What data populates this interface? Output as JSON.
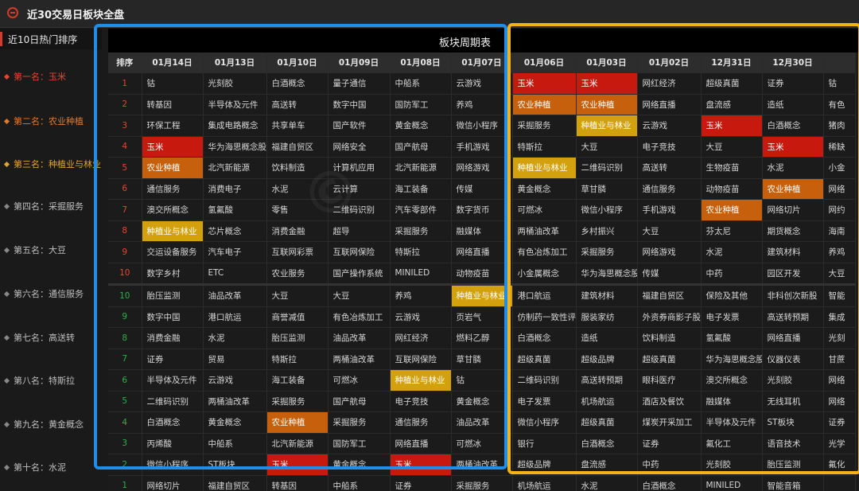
{
  "window": {
    "title": "近30交易日板块全盘"
  },
  "sidebar": {
    "header": "近10日热门排序",
    "items": [
      {
        "label": "第一名：玉米",
        "level": "top1"
      },
      {
        "label": "第二名：农业种植",
        "level": "top2"
      },
      {
        "label": "第三名：种植业与林业",
        "level": "top3"
      },
      {
        "label": "第四名：采掘服务",
        "level": ""
      },
      {
        "label": "第五名：大豆",
        "level": ""
      },
      {
        "label": "第六名：通信服务",
        "level": ""
      },
      {
        "label": "第七名：高送转",
        "level": ""
      },
      {
        "label": "第八名：特斯拉",
        "level": ""
      },
      {
        "label": "第九名：黄金概念",
        "level": ""
      },
      {
        "label": "第十名：水泥",
        "level": ""
      }
    ]
  },
  "panel": {
    "title": "板块周期表"
  },
  "table": {
    "rank_header": "排序",
    "dates": [
      "01月14日",
      "01月13日",
      "01月10日",
      "01月09日",
      "01月08日",
      "01月07日",
      "01月06日",
      "01月03日",
      "01月02日",
      "12月31日",
      "12月30日",
      ""
    ],
    "rows": [
      {
        "rank": "1",
        "dir": "up",
        "cells": [
          [
            "钴",
            ""
          ],
          [
            "光刻胶",
            ""
          ],
          [
            "白酒概念",
            ""
          ],
          [
            "量子通信",
            ""
          ],
          [
            "中船系",
            ""
          ],
          [
            "云游戏",
            ""
          ],
          [
            "玉米",
            "red"
          ],
          [
            "玉米",
            "red"
          ],
          [
            "网红经济",
            ""
          ],
          [
            "超级真菌",
            ""
          ],
          [
            "证券",
            ""
          ],
          [
            "钴",
            ""
          ]
        ]
      },
      {
        "rank": "2",
        "dir": "up",
        "cells": [
          [
            "转基因",
            ""
          ],
          [
            "半导体及元件",
            ""
          ],
          [
            "高送转",
            ""
          ],
          [
            "数字中国",
            ""
          ],
          [
            "国防军工",
            ""
          ],
          [
            "养鸡",
            ""
          ],
          [
            "农业种植",
            "org"
          ],
          [
            "农业种植",
            "org"
          ],
          [
            "网络直播",
            ""
          ],
          [
            "盘流感",
            ""
          ],
          [
            "造纸",
            ""
          ],
          [
            "有色",
            ""
          ]
        ]
      },
      {
        "rank": "3",
        "dir": "up",
        "cells": [
          [
            "环保工程",
            ""
          ],
          [
            "集成电路概念",
            ""
          ],
          [
            "共享单车",
            ""
          ],
          [
            "国产软件",
            ""
          ],
          [
            "黄金概念",
            ""
          ],
          [
            "微信小程序",
            ""
          ],
          [
            "采掘服务",
            ""
          ],
          [
            "种植业与林业",
            "yel"
          ],
          [
            "云游戏",
            ""
          ],
          [
            "玉米",
            "red"
          ],
          [
            "白酒概念",
            ""
          ],
          [
            "猪肉",
            ""
          ]
        ]
      },
      {
        "rank": "4",
        "dir": "up",
        "cells": [
          [
            "玉米",
            "red"
          ],
          [
            "华为海思概念股",
            ""
          ],
          [
            "福建自贸区",
            ""
          ],
          [
            "网络安全",
            ""
          ],
          [
            "国产航母",
            ""
          ],
          [
            "手机游戏",
            ""
          ],
          [
            "特斯拉",
            ""
          ],
          [
            "大豆",
            ""
          ],
          [
            "电子竞技",
            ""
          ],
          [
            "大豆",
            ""
          ],
          [
            "玉米",
            "red"
          ],
          [
            "稀缺",
            ""
          ]
        ]
      },
      {
        "rank": "5",
        "dir": "up",
        "cells": [
          [
            "农业种植",
            "org"
          ],
          [
            "北汽新能源",
            ""
          ],
          [
            "饮料制造",
            ""
          ],
          [
            "计算机应用",
            ""
          ],
          [
            "北汽新能源",
            ""
          ],
          [
            "网络游戏",
            ""
          ],
          [
            "种植业与林业",
            "yel"
          ],
          [
            "二维码识别",
            ""
          ],
          [
            "高送转",
            ""
          ],
          [
            "生物疫苗",
            ""
          ],
          [
            "水泥",
            ""
          ],
          [
            "小金",
            ""
          ]
        ]
      },
      {
        "rank": "6",
        "dir": "up",
        "cells": [
          [
            "通信服务",
            ""
          ],
          [
            "消费电子",
            ""
          ],
          [
            "水泥",
            ""
          ],
          [
            "云计算",
            ""
          ],
          [
            "海工装备",
            ""
          ],
          [
            "传媒",
            ""
          ],
          [
            "黄金概念",
            ""
          ],
          [
            "草甘膦",
            ""
          ],
          [
            "通信服务",
            ""
          ],
          [
            "动物疫苗",
            ""
          ],
          [
            "农业种植",
            "org"
          ],
          [
            "网络",
            ""
          ]
        ]
      },
      {
        "rank": "7",
        "dir": "up",
        "cells": [
          [
            "澳交所概念",
            ""
          ],
          [
            "氢氟酸",
            ""
          ],
          [
            "零售",
            ""
          ],
          [
            "二维码识别",
            ""
          ],
          [
            "汽车零部件",
            ""
          ],
          [
            "数字货币",
            ""
          ],
          [
            "可燃冰",
            ""
          ],
          [
            "微信小程序",
            ""
          ],
          [
            "手机游戏",
            ""
          ],
          [
            "农业种植",
            "org"
          ],
          [
            "网络切片",
            ""
          ],
          [
            "网约",
            ""
          ]
        ]
      },
      {
        "rank": "8",
        "dir": "up",
        "cells": [
          [
            "种植业与林业",
            "yel"
          ],
          [
            "芯片概念",
            ""
          ],
          [
            "消费金融",
            ""
          ],
          [
            "超导",
            ""
          ],
          [
            "采掘服务",
            ""
          ],
          [
            "融媒体",
            ""
          ],
          [
            "两桶油改革",
            ""
          ],
          [
            "乡村振兴",
            ""
          ],
          [
            "大豆",
            ""
          ],
          [
            "芬太尼",
            ""
          ],
          [
            "期货概念",
            ""
          ],
          [
            "海南",
            ""
          ]
        ]
      },
      {
        "rank": "9",
        "dir": "up",
        "cells": [
          [
            "交运设备服务",
            ""
          ],
          [
            "汽车电子",
            ""
          ],
          [
            "互联网彩票",
            ""
          ],
          [
            "互联网保险",
            ""
          ],
          [
            "特斯拉",
            ""
          ],
          [
            "网络直播",
            ""
          ],
          [
            "有色冶炼加工",
            ""
          ],
          [
            "采掘服务",
            ""
          ],
          [
            "网络游戏",
            ""
          ],
          [
            "水泥",
            ""
          ],
          [
            "建筑材料",
            ""
          ],
          [
            "养鸡",
            ""
          ]
        ]
      },
      {
        "rank": "10",
        "dir": "up",
        "cells": [
          [
            "数字乡村",
            ""
          ],
          [
            "ETC",
            ""
          ],
          [
            "农业服务",
            ""
          ],
          [
            "国产操作系统",
            ""
          ],
          [
            "MINILED",
            ""
          ],
          [
            "动物疫苗",
            ""
          ],
          [
            "小金属概念",
            ""
          ],
          [
            "华为海思概念股",
            ""
          ],
          [
            "传媒",
            ""
          ],
          [
            "中药",
            ""
          ],
          [
            "园区开发",
            ""
          ],
          [
            "大豆",
            ""
          ]
        ]
      },
      {
        "rank": "10",
        "dir": "dn",
        "sep": true,
        "cells": [
          [
            "胎压监测",
            ""
          ],
          [
            "油品改革",
            ""
          ],
          [
            "大豆",
            ""
          ],
          [
            "大豆",
            ""
          ],
          [
            "养鸡",
            ""
          ],
          [
            "种植业与林业",
            "yel"
          ],
          [
            "港口航运",
            ""
          ],
          [
            "建筑材料",
            ""
          ],
          [
            "福建自贸区",
            ""
          ],
          [
            "保险及其他",
            ""
          ],
          [
            "非科创次新股",
            ""
          ],
          [
            "智能",
            ""
          ]
        ]
      },
      {
        "rank": "9",
        "dir": "dn",
        "cells": [
          [
            "数字中国",
            ""
          ],
          [
            "港口航运",
            ""
          ],
          [
            "商誉减值",
            ""
          ],
          [
            "有色冶炼加工",
            ""
          ],
          [
            "云游戏",
            ""
          ],
          [
            "页岩气",
            ""
          ],
          [
            "仿制药一致性评价",
            ""
          ],
          [
            "服装家纺",
            ""
          ],
          [
            "外资券商影子股",
            ""
          ],
          [
            "电子发票",
            ""
          ],
          [
            "高送转预期",
            ""
          ],
          [
            "集成",
            ""
          ]
        ]
      },
      {
        "rank": "8",
        "dir": "dn",
        "cells": [
          [
            "消费金融",
            ""
          ],
          [
            "水泥",
            ""
          ],
          [
            "胎压监测",
            ""
          ],
          [
            "油品改革",
            ""
          ],
          [
            "网红经济",
            ""
          ],
          [
            "燃料乙醇",
            ""
          ],
          [
            "白酒概念",
            ""
          ],
          [
            "造纸",
            ""
          ],
          [
            "饮料制造",
            ""
          ],
          [
            "氢氟酸",
            ""
          ],
          [
            "网络直播",
            ""
          ],
          [
            "光刻",
            ""
          ]
        ]
      },
      {
        "rank": "7",
        "dir": "dn",
        "cells": [
          [
            "证券",
            ""
          ],
          [
            "贸易",
            ""
          ],
          [
            "特斯拉",
            ""
          ],
          [
            "两桶油改革",
            ""
          ],
          [
            "互联网保险",
            ""
          ],
          [
            "草甘膦",
            ""
          ],
          [
            "超级真菌",
            ""
          ],
          [
            "超级品牌",
            ""
          ],
          [
            "超级真菌",
            ""
          ],
          [
            "华为海思概念股",
            ""
          ],
          [
            "仪器仪表",
            ""
          ],
          [
            "甘蔗",
            ""
          ]
        ]
      },
      {
        "rank": "6",
        "dir": "dn",
        "cells": [
          [
            "半导体及元件",
            ""
          ],
          [
            "云游戏",
            ""
          ],
          [
            "海工装备",
            ""
          ],
          [
            "可燃冰",
            ""
          ],
          [
            "种植业与林业",
            "yel"
          ],
          [
            "钴",
            ""
          ],
          [
            "二维码识别",
            ""
          ],
          [
            "高送转预期",
            ""
          ],
          [
            "眼科医疗",
            ""
          ],
          [
            "澳交所概念",
            ""
          ],
          [
            "光刻胶",
            ""
          ],
          [
            "网络",
            ""
          ]
        ]
      },
      {
        "rank": "5",
        "dir": "dn",
        "cells": [
          [
            "二维码识别",
            ""
          ],
          [
            "两桶油改革",
            ""
          ],
          [
            "采掘服务",
            ""
          ],
          [
            "国产航母",
            ""
          ],
          [
            "电子竞技",
            ""
          ],
          [
            "黄金概念",
            ""
          ],
          [
            "电子发票",
            ""
          ],
          [
            "机场航运",
            ""
          ],
          [
            "酒店及餐饮",
            ""
          ],
          [
            "融媒体",
            ""
          ],
          [
            "无线耳机",
            ""
          ],
          [
            "网络",
            ""
          ]
        ]
      },
      {
        "rank": "4",
        "dir": "dn",
        "cells": [
          [
            "白酒概念",
            ""
          ],
          [
            "黄金概念",
            ""
          ],
          [
            "农业种植",
            "org"
          ],
          [
            "采掘服务",
            ""
          ],
          [
            "通信服务",
            ""
          ],
          [
            "油品改革",
            ""
          ],
          [
            "微信小程序",
            ""
          ],
          [
            "超级真菌",
            ""
          ],
          [
            "煤炭开采加工",
            ""
          ],
          [
            "半导体及元件",
            ""
          ],
          [
            "ST板块",
            ""
          ],
          [
            "证券",
            ""
          ]
        ]
      },
      {
        "rank": "3",
        "dir": "dn",
        "cells": [
          [
            "丙烯酸",
            ""
          ],
          [
            "中船系",
            ""
          ],
          [
            "北汽新能源",
            ""
          ],
          [
            "国防军工",
            ""
          ],
          [
            "网络直播",
            ""
          ],
          [
            "可燃冰",
            ""
          ],
          [
            "银行",
            ""
          ],
          [
            "白酒概念",
            ""
          ],
          [
            "证券",
            ""
          ],
          [
            "氟化工",
            ""
          ],
          [
            "语音技术",
            ""
          ],
          [
            "光学",
            ""
          ]
        ]
      },
      {
        "rank": "2",
        "dir": "dn",
        "cells": [
          [
            "微信小程序",
            ""
          ],
          [
            "ST板块",
            ""
          ],
          [
            "玉米",
            "red"
          ],
          [
            "黄金概念",
            ""
          ],
          [
            "玉米",
            "red"
          ],
          [
            "两桶油改革",
            ""
          ],
          [
            "超级品牌",
            ""
          ],
          [
            "盘流感",
            ""
          ],
          [
            "中药",
            ""
          ],
          [
            "光刻胶",
            ""
          ],
          [
            "胎压监测",
            ""
          ],
          [
            "氟化",
            ""
          ]
        ]
      },
      {
        "rank": "1",
        "dir": "dn",
        "cells": [
          [
            "网络切片",
            ""
          ],
          [
            "福建自贸区",
            ""
          ],
          [
            "转基因",
            ""
          ],
          [
            "中船系",
            ""
          ],
          [
            "证券",
            ""
          ],
          [
            "采掘服务",
            ""
          ],
          [
            "机场航运",
            ""
          ],
          [
            "水泥",
            ""
          ],
          [
            "白酒概念",
            ""
          ],
          [
            "MINILED",
            ""
          ],
          [
            "智能音箱",
            ""
          ],
          [
            "",
            ""
          ]
        ]
      }
    ]
  },
  "highlight_colors": {
    "red": "#c8190f",
    "org": "#c6600c",
    "yel": "#d4a10e"
  },
  "icons": {
    "logo": "logo-icon"
  }
}
